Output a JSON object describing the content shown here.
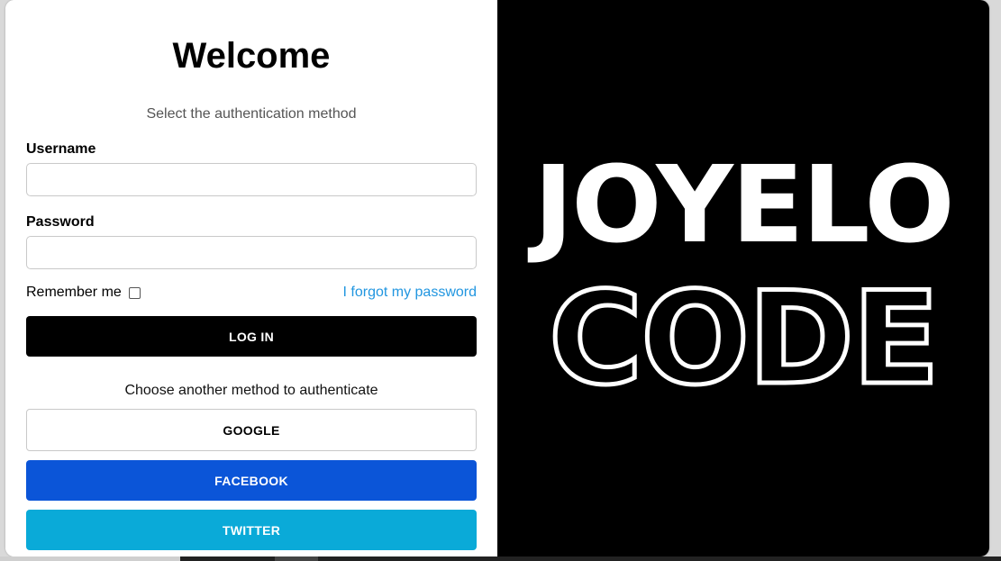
{
  "login": {
    "title": "Welcome",
    "subtitle": "Select the authentication method",
    "username_label": "Username",
    "username_value": "",
    "password_label": "Password",
    "password_value": "",
    "remember_label": "Remember me",
    "remember_checked": false,
    "forgot_link": "I forgot my password",
    "login_button": "LOG IN",
    "alt_methods_text": "Choose another method to authenticate",
    "google_button": "GOOGLE",
    "facebook_button": "FACEBOOK",
    "twitter_button": "TWITTER"
  },
  "brand": {
    "line1": "JOYELO",
    "line2": "CODE"
  },
  "colors": {
    "login_button": "#000000",
    "facebook": "#0b55d8",
    "twitter": "#0aaad8",
    "link": "#2196e0",
    "brand_panel": "#000000"
  }
}
